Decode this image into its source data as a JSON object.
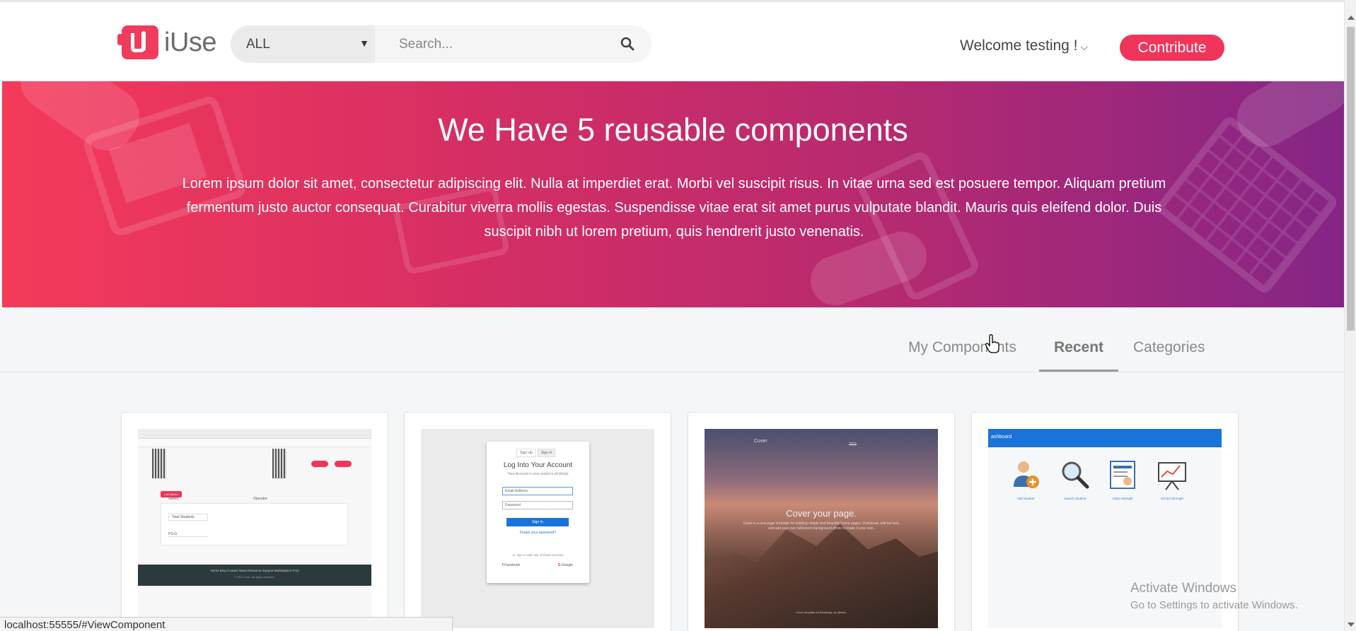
{
  "header": {
    "logo_text": "iUse",
    "search_scope": "ALL",
    "search_placeholder": "Search...",
    "welcome": "Welcome testing !",
    "contribute_label": "Contribute"
  },
  "hero": {
    "title": "We Have 5 reusable components",
    "text": "Lorem ipsum dolor sit amet, consectetur adipiscing elit. Nulla at imperdiet erat. Morbi vel suscipit risus. In vitae urna sed est posuere tempor. Aliquam pretium fermentum justo auctor consequat. Curabitur viverra mollis egestas. Suspendisse vitae erat sit amet purus vulputate blandit. Mauris quis eleifend dolor. Duis suscipit nibh ut lorem pretium, quis hendrerit justo venenatis."
  },
  "tabs": [
    {
      "label": "My Components",
      "active": false
    },
    {
      "label": "Recent",
      "active": true
    },
    {
      "label": "Categories",
      "active": false
    }
  ],
  "cards": {
    "login": {
      "tab_signup": "Sign Up",
      "tab_signin": "Sign In",
      "title": "Log Into Your Account",
      "subtitle": "Your Account is your portal to all things",
      "email_placeholder": "Email Address",
      "password_placeholder": "Password",
      "button": "Sign In",
      "forgot": "Forgot your password?",
      "or_text": "or, sign in with one of these services",
      "facebook": "Facebook",
      "google": "Google"
    },
    "cover": {
      "brand": "Cover",
      "nav_item": "Home",
      "title": "Cover your page.",
      "text": "Cover is a one-page template for building simple and beautiful home pages. Download, edit the text, and add your own fullscreen background photo to make it your own.",
      "footer": "Cover template for Bootstrap, by @mdo."
    },
    "dashboard": {
      "bar_label": "ashboard",
      "items": [
        {
          "label": "Add Student",
          "icon": "add-user-icon"
        },
        {
          "label": "Search Student",
          "icon": "magnifier-icon"
        },
        {
          "label": "Class Strength",
          "icon": "report-icon"
        },
        {
          "label": "School Strength",
          "icon": "chart-board-icon"
        }
      ]
    },
    "list": {
      "button_label": "List Values",
      "col1": "Select",
      "col2": "Operator",
      "row1": "Total Students",
      "row2": "PS-G",
      "footer_links": "Home  Blog  Contact  News  Resource  Support  Marketplace  FAQ",
      "copyright": "© 2017 iUse. All rights reserved."
    }
  },
  "status_url": "localhost:55555/#ViewComponent",
  "watermark": {
    "line1": "Activate Windows",
    "line2": "Go to Settings to activate Windows."
  },
  "colors": {
    "brand": "#f0345a",
    "hero_start": "#f53a5a",
    "hero_end": "#852586"
  }
}
